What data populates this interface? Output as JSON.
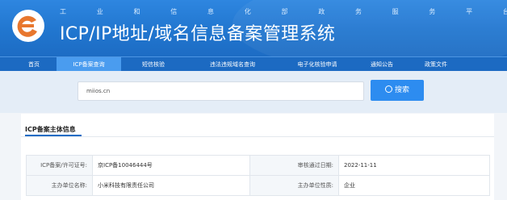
{
  "header": {
    "subtitle": "工 业 和 信 息 化 部 政 务 服 务 平 台",
    "title": "ICP/IP地址/域名信息备案管理系统"
  },
  "nav": {
    "items": [
      {
        "label": "首页"
      },
      {
        "label": "ICP备案查询",
        "active": true
      },
      {
        "label": "短信核验"
      },
      {
        "label": "违法违规域名查询"
      },
      {
        "label": "电子化核验申请"
      },
      {
        "label": "通知公告"
      },
      {
        "label": "政策文件"
      }
    ]
  },
  "search": {
    "value": "miios.cn",
    "button_label": "搜索"
  },
  "section": {
    "title": "ICP备案主体信息"
  },
  "info": {
    "license_label": "ICP备案/许可证号:",
    "license_value": "京ICP备10046444号",
    "approve_date_label": "审核通过日期:",
    "approve_date_value": "2022-11-11",
    "org_name_label": "主办单位名称:",
    "org_name_value": "小米科技有限责任公司",
    "org_type_label": "主办单位性质:",
    "org_type_value": "企业"
  },
  "colors": {
    "brand_blue": "#1d6cc4",
    "nav_active": "#4a9cef",
    "button_blue": "#2d8cf0",
    "logo_orange": "#e8772e"
  }
}
